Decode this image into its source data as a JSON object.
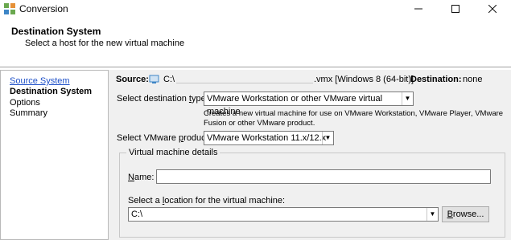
{
  "window": {
    "title": "Conversion",
    "minimize_icon": "minimize-icon",
    "maximize_icon": "maximize-icon",
    "close_icon": "close-icon"
  },
  "header": {
    "title": "Destination System",
    "subtitle": "Select a host for the new virtual machine"
  },
  "nav": {
    "items": [
      {
        "label": "Source System"
      },
      {
        "label": "Destination System"
      },
      {
        "label": "Options"
      },
      {
        "label": "Summary"
      }
    ]
  },
  "source": {
    "label": "Source:",
    "path_prefix": "C:\\",
    "path_suffix": ".vmx [Windows 8 (64-bit)]",
    "destination_label": "Destination:",
    "destination_value": "none"
  },
  "destination_type": {
    "label_pre": "Select destination ",
    "label_u": "t",
    "label_post": "ype:",
    "selected": "VMware Workstation or other VMware virtual machine",
    "description": "Creates a new virtual machine for use on VMware Workstation, VMware Player, VMware Fusion or other VMware product."
  },
  "product": {
    "label_pre": "Select VMware ",
    "label_u": "p",
    "label_post": "roduct:",
    "selected": "VMware Workstation 11.x/12.x"
  },
  "details": {
    "legend": "Virtual machine details",
    "name_label_u": "N",
    "name_label_post": "ame:",
    "name_value": "",
    "location_label_pre": "Select a ",
    "location_label_u": "l",
    "location_label_post": "ocation for the virtual machine:",
    "location_value": "C:\\",
    "browse_u": "B",
    "browse_post": "rowse..."
  }
}
